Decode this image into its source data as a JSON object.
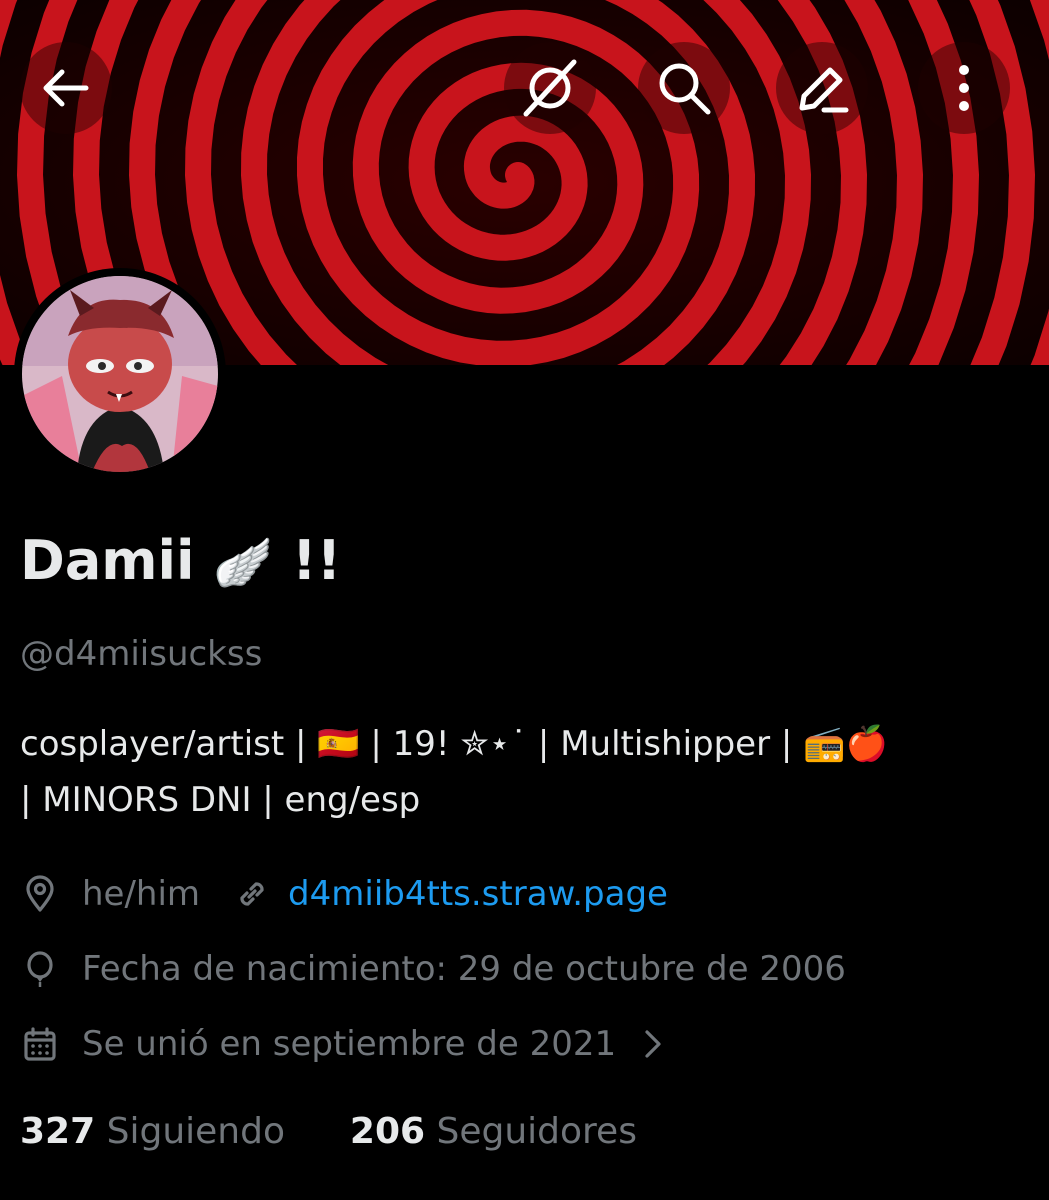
{
  "header": {
    "back_icon": "arrow-left-icon",
    "grok_icon": "grok-icon",
    "search_icon": "search-icon",
    "edit_icon": "edit-pencil-icon",
    "more_icon": "more-vertical-icon"
  },
  "colors": {
    "background": "#000000",
    "primary_text": "#e7e9ea",
    "secondary_text": "#71767b",
    "link": "#1d9bf0",
    "banner_red": "#c8141c",
    "banner_dark": "#140000"
  },
  "profile": {
    "display_name": "Damii",
    "display_name_emoji": "🪽",
    "display_name_suffix": "!!",
    "handle": "@d4miisuckss",
    "bio_line_1": "cosplayer/artist |  🇪🇸 |  19! ✮⋆˙ | Multishipper  | 📻🍎",
    "bio_line_2": "| MINORS DNI | eng/esp",
    "location": "he/him",
    "website": "d4miib4tts.straw.page",
    "birthday": "Fecha de nacimiento: 29 de octubre de 2006",
    "joined": "Se unió en septiembre de 2021",
    "following_count": "327",
    "following_label": "Siguiendo",
    "followers_count": "206",
    "followers_label": "Seguidores"
  }
}
